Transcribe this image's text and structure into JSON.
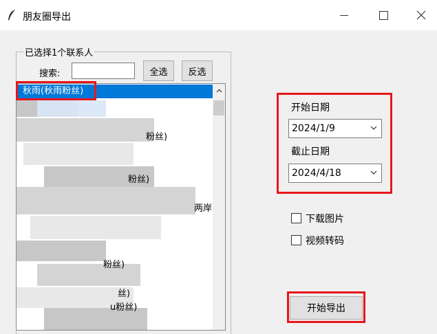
{
  "window": {
    "title": "朋友圈导出"
  },
  "contacts_group": {
    "label": "已选择1个联系人",
    "search_label": "搜索:",
    "search_value": "",
    "select_all_label": "全选",
    "invert_label": "反选",
    "items": [
      {
        "label": "秋雨(秋雨粉丝)",
        "selected": true
      },
      {
        "label": "粉丝)",
        "selected": false
      },
      {
        "label": "粉丝)",
        "selected": false
      },
      {
        "label": "两岸",
        "selected": false
      },
      {
        "label": "粉丝)",
        "selected": false
      },
      {
        "label": "丝)",
        "selected": false
      },
      {
        "label": "u粉丝)",
        "selected": false
      }
    ]
  },
  "date_range": {
    "start_label": "开始日期",
    "start_value": "2024/1/9",
    "end_label": "截止日期",
    "end_value": "2024/4/18"
  },
  "options": {
    "download_images_label": "下载图片",
    "download_images_checked": false,
    "video_transcode_label": "视频转码",
    "video_transcode_checked": false
  },
  "actions": {
    "export_label": "开始导出"
  },
  "colors": {
    "highlight": "#e8161a",
    "selection": "#0078d7"
  }
}
